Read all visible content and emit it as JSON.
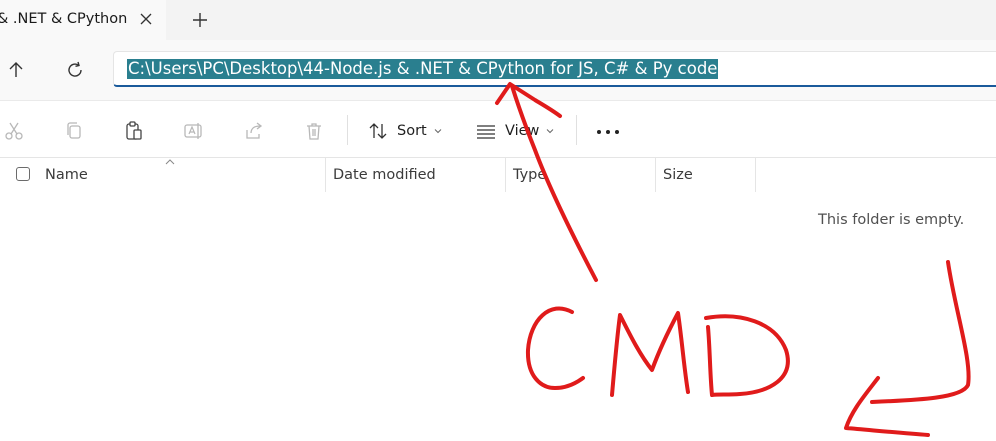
{
  "tab": {
    "title": "& .NET & CPython",
    "close": "close-icon",
    "new_tab": "plus-icon"
  },
  "nav": {
    "up": "arrow-up-icon",
    "refresh": "refresh-icon"
  },
  "address": {
    "path": "C:\\Users\\PC\\Desktop\\44-Node.js & .NET & CPython for JS, C# & Py code"
  },
  "toolbar": {
    "cut": "cut-icon",
    "copy": "copy-icon",
    "paste": "paste-icon",
    "rename": "rename-icon",
    "share": "share-icon",
    "delete": "trash-icon",
    "sort_label": "Sort",
    "view_label": "View",
    "more": "more-icon"
  },
  "columns": {
    "name": "Name",
    "date_modified": "Date modified",
    "type": "Type",
    "size": "Size"
  },
  "content": {
    "empty_message": "This folder is empty."
  },
  "annotation": {
    "text": "CMD",
    "color": "#e01b1b"
  },
  "colors": {
    "selection": "#2a7f8f",
    "accent": "#1a5a9b"
  }
}
